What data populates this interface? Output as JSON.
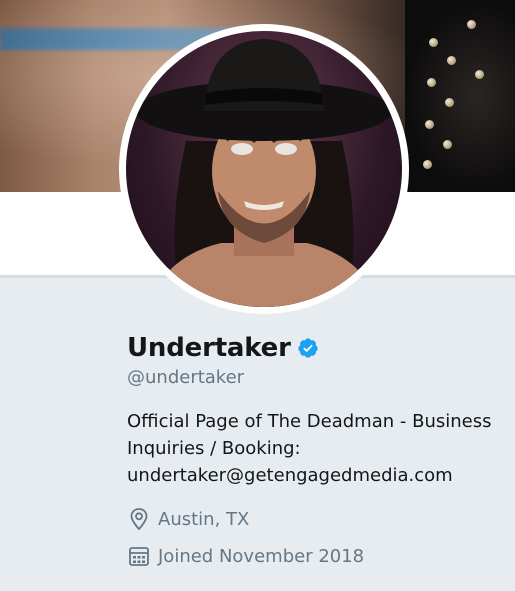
{
  "profile": {
    "name": "Undertaker",
    "handle": "@undertaker",
    "bio_lines": [
      "Official Page of The Deadman - Business",
      "Inquiries / Booking:",
      "undertaker@getengagedmedia.com"
    ],
    "location": "Austin, TX",
    "joined": "Joined November 2018",
    "verified_icon": "verified-badge-icon",
    "location_icon": "map-pin-icon",
    "joined_icon": "calendar-icon"
  },
  "colors": {
    "accent": "#1da1f2",
    "text_primary": "#14171a",
    "text_secondary": "#657786",
    "background": "#e6ecf0"
  }
}
